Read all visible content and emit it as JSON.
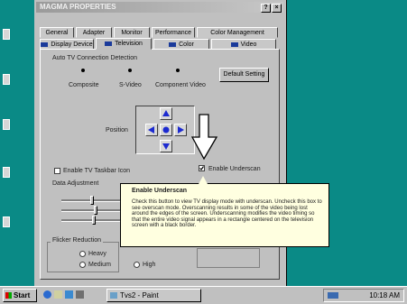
{
  "window": {
    "title": "MAGMA PROPERTIES",
    "help_label": "?",
    "close_label": "×"
  },
  "tabs_row1": [
    "General",
    "Adapter",
    "Monitor",
    "Performance",
    "Color Management"
  ],
  "tabs_row2": [
    "Display Device",
    "Television",
    "Color",
    "Video"
  ],
  "selected_tab": "Television",
  "tv_detection": {
    "group_label": "Auto TV Connection Detection",
    "connectors": [
      "Composite",
      "S-Video",
      "Component Video"
    ],
    "default_button": "Default Setting"
  },
  "position": {
    "label": "Position"
  },
  "options": {
    "enable_tv_icon": "Enable TV Taskbar Icon",
    "enable_underscan": "Enable Underscan",
    "underscan_checked": true
  },
  "adjustment": {
    "label": "Data Adjustment"
  },
  "flicker": {
    "label": "Flicker Reduction",
    "options": [
      "Heavy",
      "Medium",
      "High"
    ]
  },
  "tooltip": {
    "title": "Enable Underscan",
    "body": "Check this button to view TV display mode with underscan. Uncheck this box to see overscan mode. Overscanning results in some of the video being lost around the edges of the screen. Underscanning modifies the video timing so that the entire video signal appears in a rectangle centered on the television screen with a black border."
  },
  "taskbar": {
    "start_label": "Start",
    "task_label": "Tvs2 - Paint",
    "clock": "10:18 AM"
  },
  "colors": {
    "desktop": "#0a8a86",
    "tooltip_bg": "#ffffe0",
    "arrow_blue": "#1c2ad0"
  }
}
